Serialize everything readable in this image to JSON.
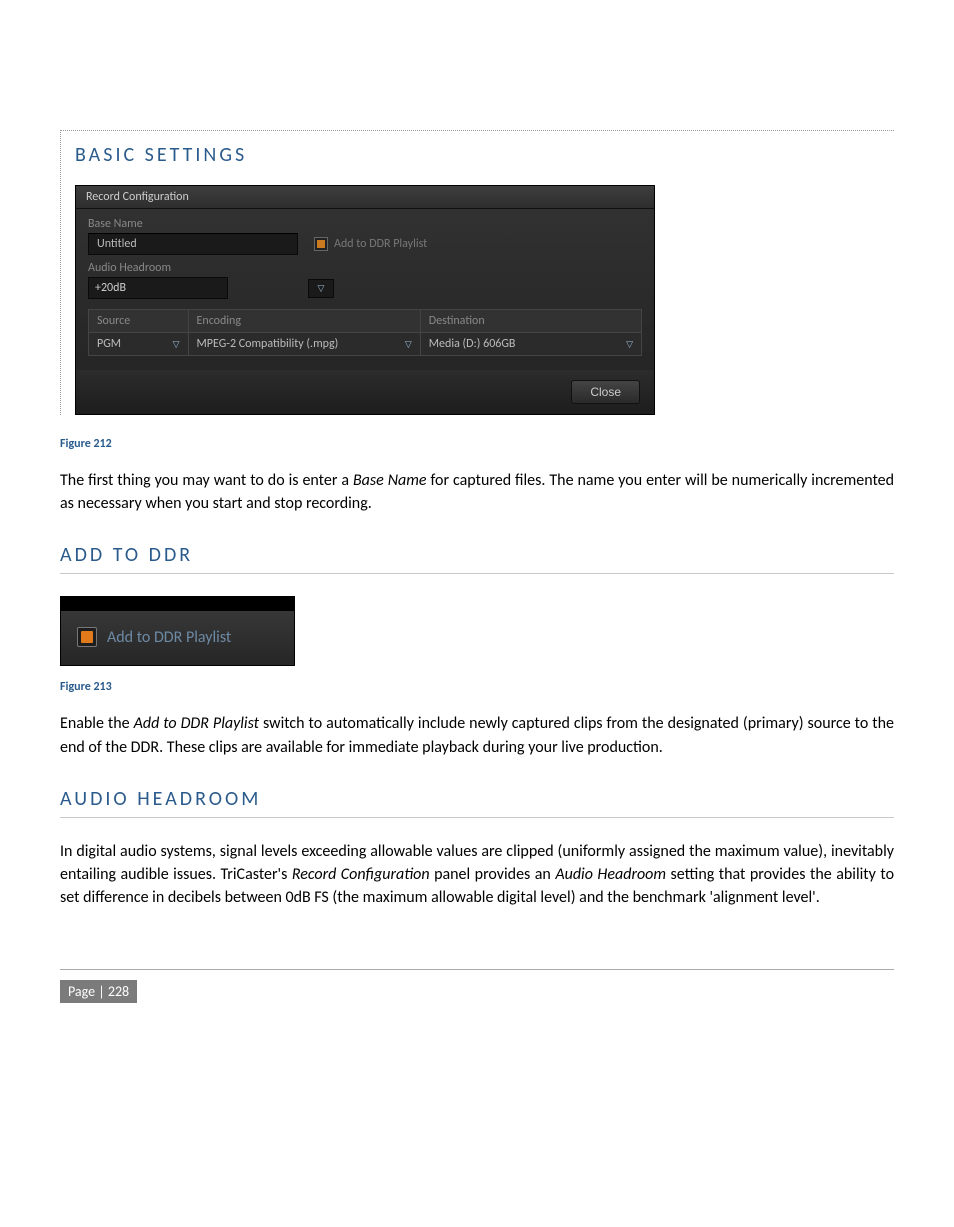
{
  "headings": {
    "basic_settings": "BASIC SETTINGS",
    "add_to_ddr": "ADD TO DDR",
    "audio_headroom": "AUDIO HEADROOM"
  },
  "figure212": {
    "title": "Record Configuration",
    "base_name_label": "Base Name",
    "base_name_value": "Untitled",
    "add_to_ddr_label": "Add to DDR Playlist",
    "audio_headroom_label": "Audio Headroom",
    "audio_headroom_value": "+20dB",
    "cols": {
      "source": "Source",
      "encoding": "Encoding",
      "destination": "Destination"
    },
    "row": {
      "source": "PGM",
      "encoding": "MPEG-2 Compatibility (.mpg)",
      "destination": "Media (D:) 606GB"
    },
    "close": "Close",
    "caption": "Figure 212"
  },
  "paragraph1a": "The first thing you may want to do is enter a ",
  "paragraph1_em": "Base Name",
  "paragraph1b": " for captured files.  The name you enter will be numerically incremented as necessary when you start and stop recording.",
  "figure213": {
    "label": "Add to DDR Playlist",
    "caption": "Figure 213"
  },
  "paragraph2a": "Enable the ",
  "paragraph2_em1": "Add to DDR Playlist",
  "paragraph2b": " switch to automatically include newly captured clips from the designated (primary) source to the end of the DDR.  These clips are available for immediate playback during your live production.",
  "paragraph3a": "In digital audio systems, signal levels exceeding allowable values are clipped (uniformly assigned the maximum value), inevitably entailing audible issues. TriCaster's ",
  "paragraph3_em1": "Record Configuration",
  "paragraph3b": " panel provides an ",
  "paragraph3_em2": "Audio Headroom",
  "paragraph3c": " setting that provides the ability to set difference in decibels between 0dB FS (the maximum allowable digital level) and the benchmark 'alignment level'.",
  "footer": {
    "page": "Page | 228"
  }
}
